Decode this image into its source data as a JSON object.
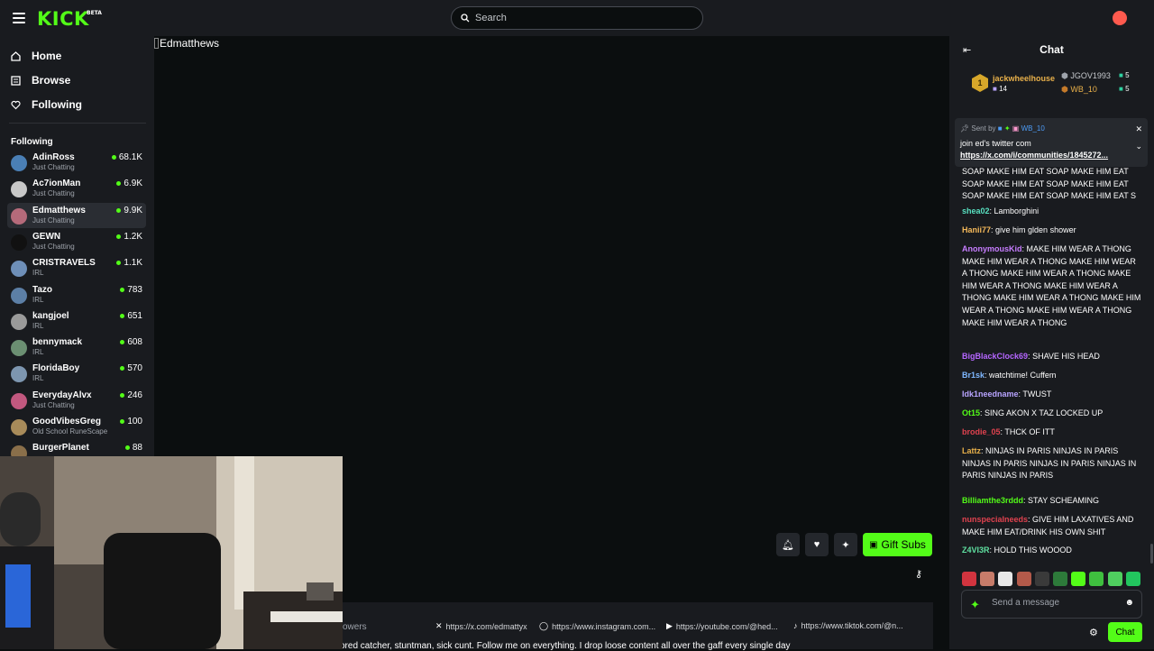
{
  "header": {
    "logo": "KICK",
    "logo_badge": "BETA",
    "search_placeholder": "Search"
  },
  "sidebar": {
    "nav": [
      {
        "label": "Home",
        "icon": "home-icon"
      },
      {
        "label": "Browse",
        "icon": "browse-icon"
      },
      {
        "label": "Following",
        "icon": "heart-icon"
      }
    ],
    "following_heading": "Following",
    "channels": [
      {
        "name": "AdinRoss",
        "category": "Just Chatting",
        "viewers": "68.1K",
        "avatar_color": "#4a7fb5"
      },
      {
        "name": "Ac7ionMan",
        "category": "Just Chatting",
        "viewers": "6.9K",
        "avatar_color": "#c8c8c8"
      },
      {
        "name": "Edmatthews",
        "category": "Just Chatting",
        "viewers": "9.9K",
        "avatar_color": "#b56a7a"
      },
      {
        "name": "GEWN",
        "category": "Just Chatting",
        "viewers": "1.2K",
        "avatar_color": "#111111"
      },
      {
        "name": "CRISTRAVELS",
        "category": "IRL",
        "viewers": "1.1K",
        "avatar_color": "#6e8fb8"
      },
      {
        "name": "Tazo",
        "category": "IRL",
        "viewers": "783",
        "avatar_color": "#5c7fa6"
      },
      {
        "name": "kangjoel",
        "category": "IRL",
        "viewers": "651",
        "avatar_color": "#9a9a9a"
      },
      {
        "name": "bennymack",
        "category": "IRL",
        "viewers": "608",
        "avatar_color": "#6b8f72"
      },
      {
        "name": "FloridaBoy",
        "category": "IRL",
        "viewers": "570",
        "avatar_color": "#7d96b0"
      },
      {
        "name": "EverydayAlvx",
        "category": "Just Chatting",
        "viewers": "246",
        "avatar_color": "#c2587f"
      },
      {
        "name": "GoodVibesGreg",
        "category": "Old School RuneScape",
        "viewers": "100",
        "avatar_color": "#a88b5a"
      },
      {
        "name": "BurgerPlanet",
        "category": "",
        "viewers": "88",
        "avatar_color": "#8a6f4a"
      }
    ]
  },
  "player": {
    "alt_text": "Edmatthews"
  },
  "actions": {
    "gift_label": "Gift Subs"
  },
  "about": {
    "followers_label": "owers",
    "bio": "ored catcher, stuntman, sick cunt. Follow me on everything. I drop loose content all over the gaff every single day",
    "links": [
      {
        "icon": "x-icon",
        "label": "https://x.com/edmattyx"
      },
      {
        "icon": "instagram-icon",
        "label": "https://www.instagram.com..."
      },
      {
        "icon": "youtube-icon",
        "label": "https://youtube.com/@hed..."
      },
      {
        "icon": "tiktok-icon",
        "label": "https://www.tiktok.com/@n..."
      }
    ]
  },
  "chat": {
    "title": "Chat",
    "leaderboard": {
      "rank": "1",
      "top_user": "jackwheelhouse",
      "top_user_count": "14",
      "second_user": "JGOV1993",
      "second_count": "5",
      "third_user": "WB_10",
      "third_count": "5"
    },
    "pinned": {
      "sent_by_label": "Sent by",
      "sent_by_user": "WB_10",
      "line1": "join ed's twitter com",
      "line2": "https://x.com/i/communities/1845272..."
    },
    "messages": [
      {
        "user": "",
        "color": "#ffffff",
        "text": "SOAP MAKE HIM EAT SOAP MAKE HIM EAT SOAP MAKE HIM EAT SOAP MAKE HIM EAT SOAP MAKE HIM EAT SOAP MAKE HIM EAT S"
      },
      {
        "user": "shea02",
        "color": "#58e0c0",
        "text": "Lamborghini"
      },
      {
        "user": "Hanii77",
        "color": "#f5b95a",
        "text": "give him glden shower"
      },
      {
        "user": "AnonymousKid",
        "color": "#c77dff",
        "text": "MAKE HIM WEAR A THONG MAKE HIM WEAR A THONG MAKE HIM WEAR A THONG MAKE HIM WEAR A THONG MAKE HIM WEAR A THONG MAKE HIM WEAR A THONG MAKE HIM WEAR A THONG MAKE HIM WEAR A THONG MAKE HIM WEAR A THONG MAKE HIM WEAR A THONG"
      },
      {
        "user": "BigBlackClock69",
        "color": "#b566ff",
        "text": "SHAVE HIS HEAD"
      },
      {
        "user": "Br1sk",
        "color": "#7fb8ff",
        "text": "watchtime! Cuffem"
      },
      {
        "user": "Idk1needname",
        "color": "#b8a4ff",
        "text": "TWUST"
      },
      {
        "user": "Ot15",
        "color": "#53fc18",
        "text": "SING AKON X TAZ LOCKED UP"
      },
      {
        "user": "brodie_05",
        "color": "#e0424f",
        "text": "THCK OF ITT"
      },
      {
        "user": "Lattz",
        "color": "#e8b04a",
        "text": "NINJAS IN PARIS NINJAS IN PARIS NINJAS IN PARIS NINJAS IN PARIS NINJAS IN PARIS NINJAS IN PARIS"
      },
      {
        "user": "Billiamthe3rddd",
        "color": "#53fc18",
        "text": "STAY SCHEAMING"
      },
      {
        "user": "nunspeciaIneeds",
        "color": "#e0424f",
        "text": "GIVE HIM LAXATIVES AND MAKE HIM EAT/DRINK HIS OWN SHIT"
      },
      {
        "user": "Z4VI3R",
        "color": "#5fe0a0",
        "text": "HOLD THIS WOOOD"
      }
    ],
    "input_placeholder": "Send a message",
    "send_label": "Chat"
  }
}
